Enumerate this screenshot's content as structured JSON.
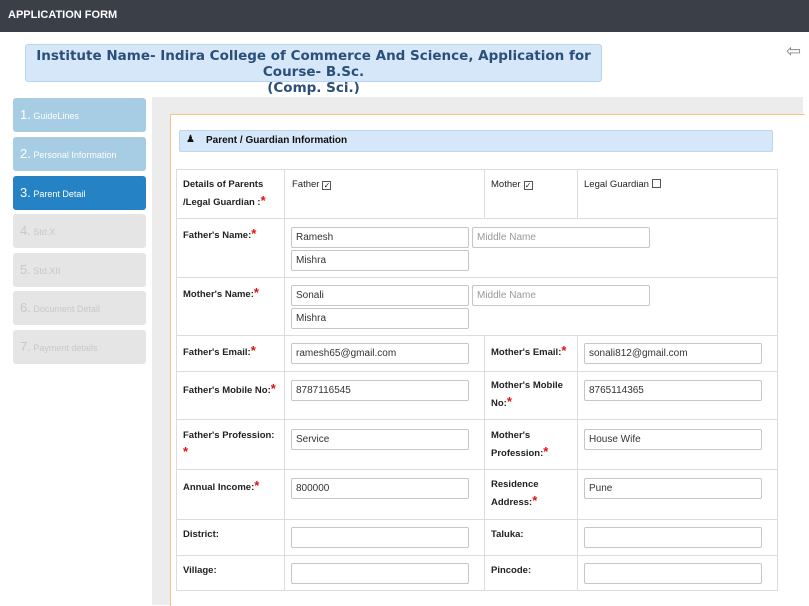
{
  "header": {
    "title": "APPLICATION FORM"
  },
  "banner": {
    "line1": "Institute Name- Indira College of Commerce And Science, Application for Course- B.Sc.",
    "line2": "(Comp. Sci.)"
  },
  "steps": [
    {
      "num": "1.",
      "label": "GuideLines"
    },
    {
      "num": "2.",
      "label": "Personal Information"
    },
    {
      "num": "3.",
      "label": "Parent Detail"
    },
    {
      "num": "4.",
      "label": "Std.X"
    },
    {
      "num": "5.",
      "label": "Std.XII"
    },
    {
      "num": "6.",
      "label": "Document Detail"
    },
    {
      "num": "7.",
      "label": "Payment details"
    }
  ],
  "section": {
    "title": "Parent / Guardian Information"
  },
  "details": {
    "label_line1": "Details of Parents",
    "label_line2": "/Legal Guardian :",
    "father": "Father",
    "mother": "Mother",
    "guardian": "Legal Guardian",
    "check_mark": "✓"
  },
  "father_name": {
    "label": "Father's Name:",
    "first": "Ramesh",
    "middle_placeholder": "Middle Name",
    "last": "Mishra"
  },
  "mother_name": {
    "label": "Mother's Name:",
    "first": "Sonali",
    "middle_placeholder": "Middle Name",
    "last": "Mishra"
  },
  "father_email": {
    "label": "Father's Email:",
    "value": "ramesh65@gmail.com"
  },
  "mother_email": {
    "label": "Mother's Email:",
    "value": "sonali812@gmail.com"
  },
  "father_mobile": {
    "label": "Father's Mobile No:",
    "value": "8787116545"
  },
  "mother_mobile": {
    "label_line1": "Mother's Mobile",
    "label_line2": "No:",
    "value": "8765114365"
  },
  "father_profession": {
    "label_line1": "Father's Profession:",
    "value": "Service"
  },
  "mother_profession": {
    "label_line1": "Mother's",
    "label_line2": "Profession:",
    "value": "House Wife"
  },
  "annual_income": {
    "label": "Annual Income:",
    "value": "800000"
  },
  "residence": {
    "label_line1": "Residence",
    "label_line2": "Address:",
    "value": "Pune"
  },
  "district": {
    "label": "District:",
    "value": ""
  },
  "taluka": {
    "label": "Taluka:",
    "value": ""
  },
  "village": {
    "label": "Village:",
    "value": ""
  },
  "pincode": {
    "label": "Pincode:",
    "value": ""
  },
  "required_mark": "*",
  "icons": {
    "back": "⇦",
    "person": "♟"
  }
}
